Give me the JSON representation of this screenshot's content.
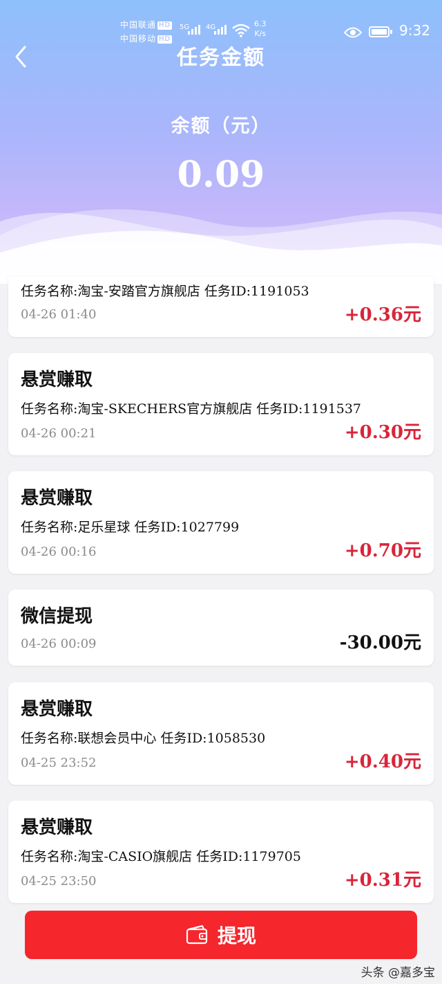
{
  "status_bar": {
    "carrier_1": "中国联通",
    "carrier_2": "中国移动",
    "hd_badge": "HD",
    "net_5g": "5G",
    "net_4g": "4G",
    "speed_value": "6.3",
    "speed_unit": "K/s",
    "time": "9:32",
    "icons": [
      "signal-icon",
      "wifi-icon",
      "eye-icon",
      "battery-icon"
    ]
  },
  "header": {
    "title": "任务金额",
    "balance_label": "余额（元）",
    "balance_value": "0.09",
    "back_icon": "chevron-left-icon"
  },
  "records": [
    {
      "title": "",
      "desc": "任务名称:淘宝-安踏官方旗舰店   任务ID:1191053",
      "date": "04-26 01:40",
      "amount": "+0.36元",
      "type": "positive",
      "partial": true
    },
    {
      "title": "悬赏赚取",
      "desc": "任务名称:淘宝-SKECHERS官方旗舰店   任务ID:1191537",
      "date": "04-26 00:21",
      "amount": "+0.30元",
      "type": "positive"
    },
    {
      "title": "悬赏赚取",
      "desc": "任务名称:足乐星球  任务ID:1027799",
      "date": "04-26 00:16",
      "amount": "+0.70元",
      "type": "positive"
    },
    {
      "title": "微信提现",
      "desc": "",
      "date": "04-26 00:09",
      "amount": "-30.00元",
      "type": "negative"
    },
    {
      "title": "悬赏赚取",
      "desc": "任务名称:联想会员中心  任务ID:1058530",
      "date": "04-25 23:52",
      "amount": "+0.40元",
      "type": "positive"
    },
    {
      "title": "悬赏赚取",
      "desc": "任务名称:淘宝-CASIO旗舰店   任务ID:1179705",
      "date": "04-25 23:50",
      "amount": "+0.31元",
      "type": "positive"
    }
  ],
  "withdraw_button": {
    "label": "提现",
    "icon": "wallet-icon"
  },
  "watermark": "头条 @嘉多宝",
  "colors": {
    "positive": "#d8253a",
    "negative": "#111111",
    "button": "#f5262c",
    "header_top": "#8ec0fb",
    "header_bottom": "#d6c8fb"
  }
}
